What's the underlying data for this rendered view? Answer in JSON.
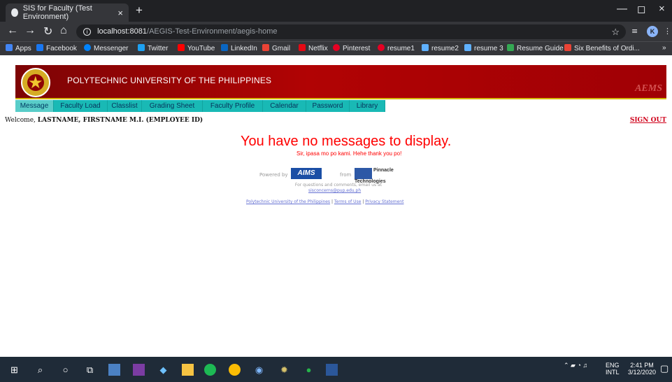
{
  "browser": {
    "tab_title": "SIS for Faculty (Test Environment)",
    "tab_close": "×",
    "new_tab": "+",
    "url_host": "localhost:8081",
    "url_path": "/AEGIS-Test-Environment/aegis-home",
    "profile_initial": "K"
  },
  "bookmarks": [
    "Apps",
    "Facebook",
    "Messenger",
    "Twitter",
    "YouTube",
    "LinkedIn",
    "Gmail",
    "Netflix",
    "Pinterest",
    "resume1",
    "resume2",
    "resume 3",
    "Resume Guide",
    "Six Benefits of Ordi...",
    "»"
  ],
  "site": {
    "university": "POLYTECHNIC UNIVERSITY OF THE PHILIPPINES",
    "system_logo": "AEMS",
    "menu": [
      "Message",
      "Faculty Load",
      "Classlist",
      "Grading Sheet",
      "Faculty Profile",
      "Calendar",
      "Password",
      "Library"
    ],
    "welcome_prefix": "Welcome, ",
    "user": "LASTNAME, FIRSTNAME M.I. (EMPLOYEE ID)",
    "sign_out": "SIGN OUT",
    "message": "You have no messages to display.",
    "submessage": "Sir, ipasa mo po kami. Hehe thank you po!",
    "powered_by": "Powered by",
    "from": "from",
    "aims_logo": "AIMS",
    "pinnacle_logo": "Pinnacle Technologies",
    "questions": "For questions and comments, email us at",
    "email": "sisconcerns@pup.edu.ph",
    "footer": [
      "Polytechnic University of the Philippines",
      "Terms of Use",
      "Privacy Statement"
    ]
  },
  "taskbar": {
    "lang": "ENG",
    "region": "INTL",
    "time": "2:41 PM",
    "date": "3/12/2020"
  }
}
